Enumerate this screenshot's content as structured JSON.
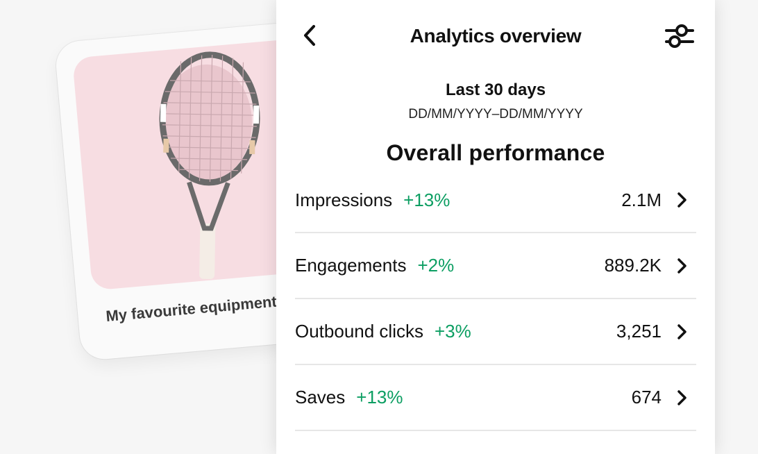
{
  "pin": {
    "caption": "My favourite equipment"
  },
  "header": {
    "title": "Analytics overview",
    "back_icon": "chevron-left-icon",
    "filter_icon": "sliders-icon"
  },
  "date_range": {
    "label": "Last 30 days",
    "dates": "DD/MM/YYYY–DD/MM/YYYY"
  },
  "section_title": "Overall performance",
  "metrics": [
    {
      "name": "Impressions",
      "change": "+13%",
      "value": "2.1M"
    },
    {
      "name": "Engagements",
      "change": "+2%",
      "value": "889.2K"
    },
    {
      "name": "Outbound clicks",
      "change": "+3%",
      "value": "3,251"
    },
    {
      "name": "Saves",
      "change": "+13%",
      "value": "674"
    }
  ],
  "colors": {
    "positive_change": "#0c9e62",
    "pin_background": "#f7dde2"
  }
}
